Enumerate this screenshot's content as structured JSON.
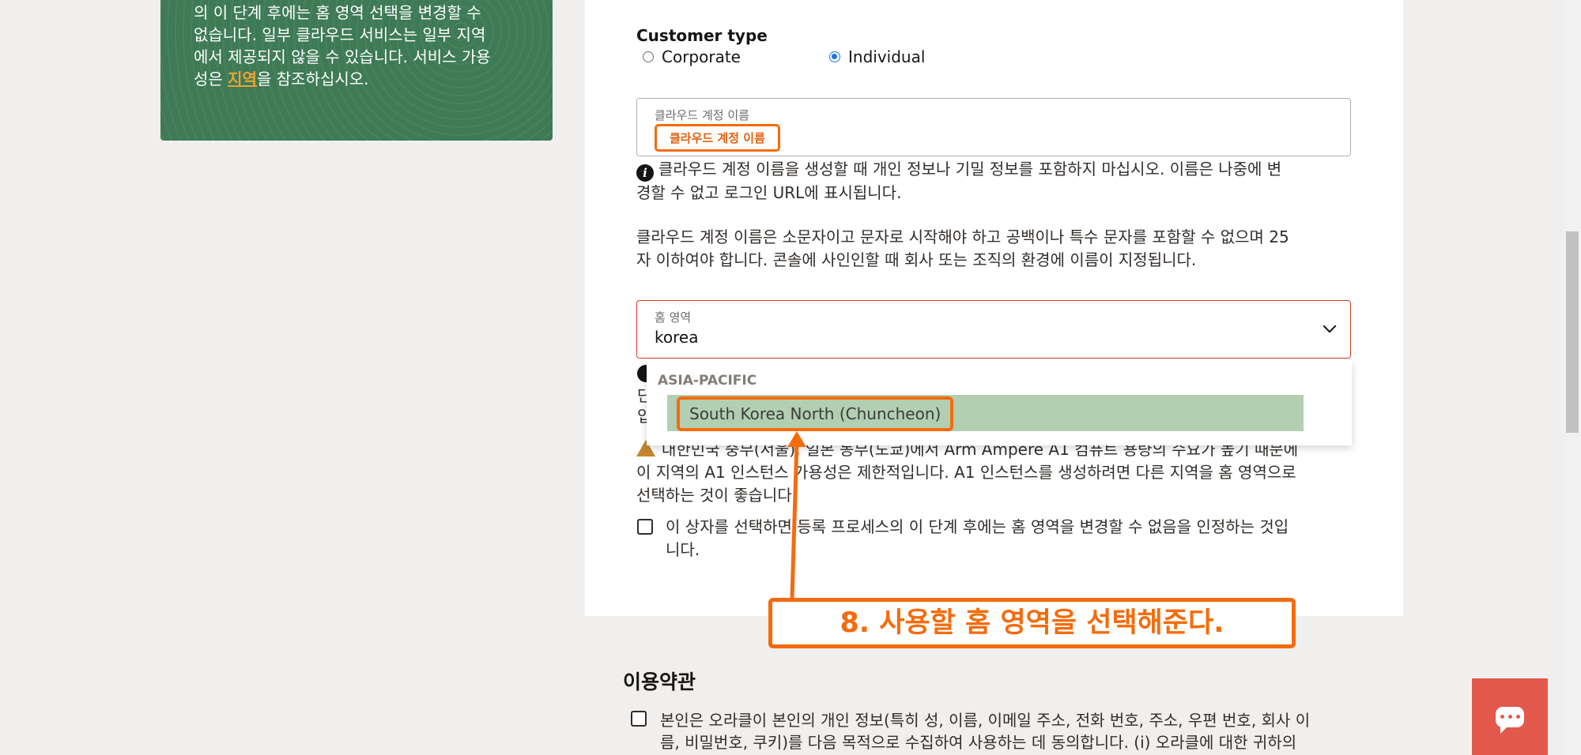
{
  "region_notice": {
    "line1": "의 이 단계 후에는 홈 영역 선택을 변경할 수",
    "line2": "없습니다. 일부 클라우드 서비스는 일부 지역",
    "line3": "에서 제공되지 않을 수 있습니다. 서비스 가용",
    "line4_prefix": "성은 ",
    "line4_link": "지역",
    "line4_suffix": "을 참조하십시오."
  },
  "customer_type": {
    "label": "Customer type",
    "options": [
      "Corporate",
      "Individual"
    ],
    "selected": "Individual"
  },
  "cloud_account": {
    "label": "클라우드 계정 이름",
    "placeholder": "클라우드 계정 이름",
    "info_line1": "클라우드 계정 이름을 생성할 때 개인 정보나 기밀 정보를 포함하지 마십시오. 이름은 나중에 변",
    "info_line2": "경할 수 없고 로그인 URL에 표시됩니다.",
    "rules_line1": "클라우드 계정 이름은 소문자이고 문자로 시작해야 하고 공백이나 특수 문자를 포함할 수 없으며 25",
    "rules_line2": "자 이하여야 합니다. 콘솔에 사인인할 때 회사 또는 조직의 환경에 이름이 지정됩니다."
  },
  "home_region": {
    "label": "홈 영역",
    "value": "korea",
    "dropdown_group": "ASIA-PACIFIC",
    "dropdown_option": "South Korea North (Chuncheon)",
    "warning_line1": "대한민국 중부(서울), 일본 동부(도쿄)에서 Arm Ampere A1 컴퓨트 용량의 수요가 높기 때문에",
    "warning_line2": "이 지역의 A1 인스턴스 가용성은 제한적입니다. A1 인스턴스를 생성하려면 다른 지역을 홈 영역으로",
    "warning_line3": "선택하는 것이 좋습니다.",
    "ack_line1": "이 상자를 선택하면 등록 프로세스의 이 단계 후에는 홈 영역을 변경할 수 없음을 인정하는 것입",
    "ack_line2": "니다."
  },
  "annotation": {
    "text": "8. 사용할 홈 영역을 선택해준다."
  },
  "terms": {
    "title": "이용약관",
    "line1": "본인은 오라클이 본인의 개인 정보(특히 성, 이름, 이메일 주소, 전화 번호, 주소, 우편 번호, 회사 이",
    "line2": "름, 비밀번호, 쿠키)를 다음 목적으로 수집하여 사용하는 데 동의합니다. (i) 오라클에 대한 귀하의"
  },
  "colors": {
    "green_panel": "#3d7a55",
    "accent_orange": "#f56b0c",
    "selected_option": "#b2cfb2",
    "chat_button": "#e2584a",
    "error_border": "#d63b25"
  }
}
